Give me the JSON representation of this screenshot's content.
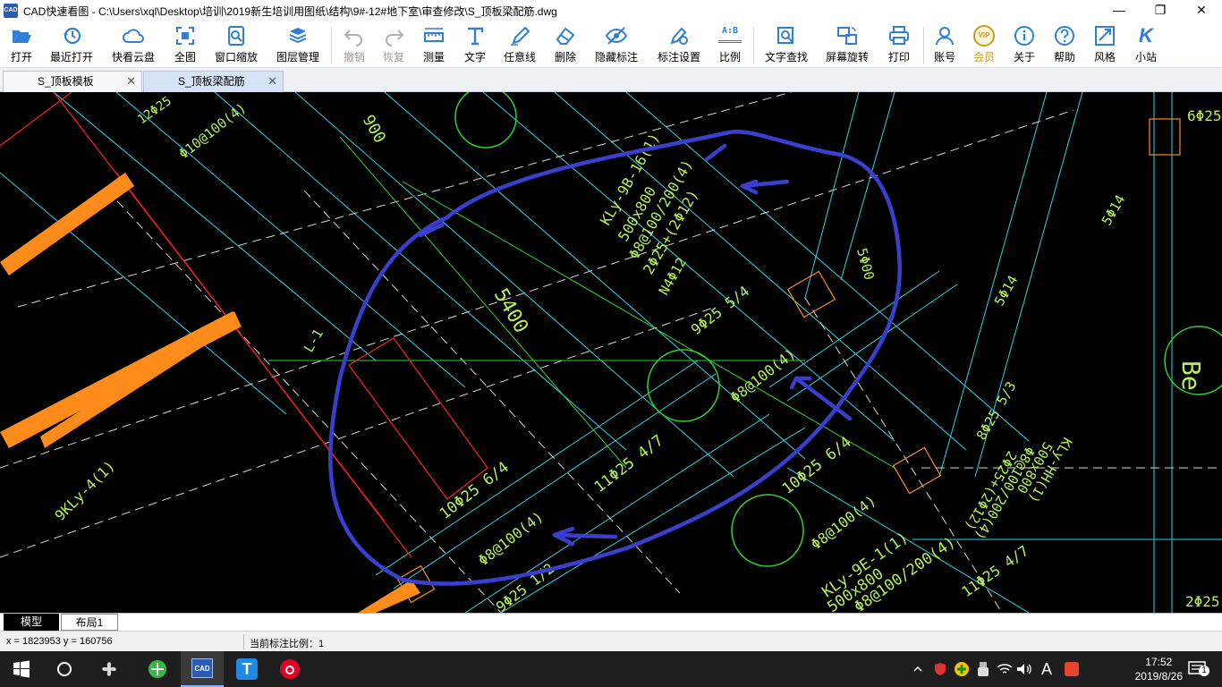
{
  "window": {
    "logo": "CAD",
    "title": "CAD快速看图 - C:\\Users\\xql\\Desktop\\培训\\2019新生培训用图纸\\结构\\9#-12#地下室\\审查修改\\S_顶板梁配筋.dwg",
    "minimize": "—",
    "maximize": "❐",
    "close": "✕"
  },
  "toolbar": {
    "items": [
      {
        "label": "打开",
        "icon": "folder-open-icon"
      },
      {
        "label": "最近打开",
        "icon": "history-icon"
      },
      {
        "label": "快看云盘",
        "icon": "cloud-icon"
      },
      {
        "label": "全图",
        "icon": "fit-all-icon"
      },
      {
        "label": "窗口缩放",
        "icon": "zoom-window-icon"
      },
      {
        "label": "图层管理",
        "icon": "layers-icon"
      },
      {
        "label": "撤销",
        "icon": "undo-icon"
      },
      {
        "label": "恢复",
        "icon": "redo-icon"
      },
      {
        "label": "测量",
        "icon": "ruler-icon"
      },
      {
        "label": "文字",
        "icon": "text-icon"
      },
      {
        "label": "任意线",
        "icon": "pen-icon"
      },
      {
        "label": "删除",
        "icon": "eraser-icon"
      },
      {
        "label": "隐藏标注",
        "icon": "eye-hide-icon"
      },
      {
        "label": "标注设置",
        "icon": "annotation-settings-icon"
      },
      {
        "label": "比例",
        "icon": "scale-icon"
      },
      {
        "label": "文字查找",
        "icon": "text-search-icon"
      },
      {
        "label": "屏幕旋转",
        "icon": "rotate-screen-icon"
      },
      {
        "label": "打印",
        "icon": "printer-icon"
      },
      {
        "label": "账号",
        "icon": "user-icon"
      },
      {
        "label": "会员",
        "icon": "vip-icon",
        "badge": "VIP"
      },
      {
        "label": "关于",
        "icon": "info-icon"
      },
      {
        "label": "帮助",
        "icon": "help-icon"
      },
      {
        "label": "风格",
        "icon": "style-icon"
      },
      {
        "label": "小站",
        "icon": "k-station-icon"
      }
    ],
    "scale_icon_text": "A:B",
    "text_icon_glyph": "T",
    "k_icon_glyph": "K"
  },
  "tabs": [
    {
      "label": "S_顶板模板",
      "close": "✕"
    },
    {
      "label": "S_顶板梁配筋",
      "close": "✕"
    }
  ],
  "drawing": {
    "labels": [
      "12Φ25",
      "Φ10@100(4)",
      "900",
      "5400",
      "L-1",
      "KLy-9B-16(1)",
      "500x800",
      "Φ8@100/200(4)",
      "2Φ25+(2Φ12)",
      "N4Φ12",
      "9Φ25 5/4",
      "Φ8@100(4)",
      "9KLy-4(1)",
      "10Φ25 6/4",
      "11Φ25 4/7",
      "10Φ25 6/4",
      "Φ8@100(4)",
      "9Φ25 1/2",
      "Φ8@100(4)",
      "KLy-9E-1(1)",
      "500x800",
      "Φ8@100/200(4)",
      "11Φ25 4/7",
      "6Φ25",
      "5Φ00",
      "5Φ14",
      "5Φ14",
      "8Φ25 5/3",
      "2Φ25+(2Φ12)",
      "Φ8@100/200(4)",
      "500x800",
      "KLy-HH(1)",
      "2Φ25",
      "Be"
    ]
  },
  "layout_tabs": {
    "model": "模型",
    "layout1": "布局1"
  },
  "status": {
    "coord": "x = 1823953  y = 160756",
    "scale": "当前标注比例：1"
  },
  "taskbar": {
    "clock_time": "17:52",
    "clock_date": "2019/8/26",
    "tray_ime": "A",
    "notification_count": "1"
  },
  "colors": {
    "annotation_stroke": "#3a3fd0",
    "cad_text": "#b8f05a",
    "column_orange": "#ff8c1a",
    "axis_green": "#2ed42e",
    "cyan_line": "#29d6e6",
    "red_outline": "#ff2020"
  }
}
